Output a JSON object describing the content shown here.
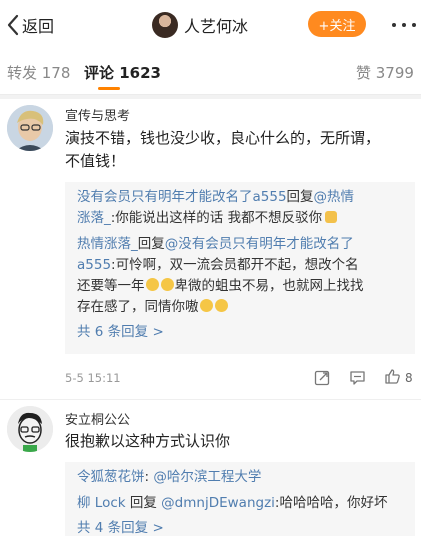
{
  "header": {
    "back_label": "返回",
    "user_name": "人艺何冰",
    "follow_label": "+关注"
  },
  "tabs": [
    {
      "label": "转发 178"
    },
    {
      "label": "评论 1623"
    },
    {
      "label": "赞 3799"
    }
  ],
  "comments": [
    {
      "user": "宣传与思考",
      "text_line1": "演技不错，钱也没少收，良心什么的，无所谓，",
      "text_line2": "不值钱！",
      "replies": {
        "r1_line1_user": "没有会员只有明年才能改名了a555",
        "r1_line1_mid": "回复",
        "r1_line1_mention": "@热情",
        "r1_line2_mention": "涨落_",
        "r1_line2_text": ":你能说出这样的话 我都不想反驳你",
        "r2_line1_user": "热情涨落_",
        "r2_line1_mid": "回复",
        "r2_line1_mention": "@没有会员只有明年才能改名了",
        "r2_line2_mention": "a555",
        "r2_line2_text": ":可怜啊，双一流会员都开不起，想改个名",
        "r2_line3_text_a": "还要等一年",
        "r2_line3_text_b": "卑微的蛆虫不易，也就网上找找",
        "r2_line4_text": "存在感了，同情你嗷",
        "more_label": "共 6 条回复 >"
      },
      "time": "5-5 15:11",
      "like_count": "8"
    },
    {
      "user": "安立桐公公",
      "text_line1": "很抱歉以这种方式认识你",
      "replies": {
        "r1_user": "令狐葱花饼",
        "r1_sep": ": ",
        "r1_mention": "@哈尔滨工程大学",
        "r2_user": "柳 Lock",
        "r2_mid": " 回复 ",
        "r2_mention": "@dmnjDEwangzi",
        "r2_text": ":哈哈哈哈，你好坏",
        "more_label": "共 4 条回复 >"
      }
    }
  ],
  "icons": [
    "chevron-left-icon",
    "more-dots-icon",
    "share-icon",
    "comment-icon",
    "thumbs-up-icon"
  ],
  "colors": {
    "accent": "#ff8200",
    "link": "#507daf",
    "follow_bg": "#ff8a1f"
  }
}
